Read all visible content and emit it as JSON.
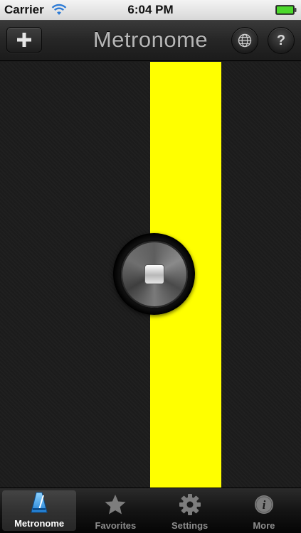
{
  "status_bar": {
    "carrier": "Carrier",
    "time": "6:04 PM"
  },
  "nav": {
    "title": "Metronome",
    "add_icon": "plus-icon",
    "globe_icon": "globe-icon",
    "help_label": "?"
  },
  "main": {
    "beat_color": "#ffff00",
    "control_icon": "stop-icon"
  },
  "tabs": [
    {
      "label": "Metronome",
      "icon": "metronome-icon",
      "active": true
    },
    {
      "label": "Favorites",
      "icon": "star-icon",
      "active": false
    },
    {
      "label": "Settings",
      "icon": "gear-icon",
      "active": false
    },
    {
      "label": "More",
      "icon": "info-icon",
      "active": false
    }
  ],
  "colors": {
    "accent": "#ffff00",
    "active_tab_icon": "#3fa9f5",
    "battery": "#4cd82c"
  }
}
